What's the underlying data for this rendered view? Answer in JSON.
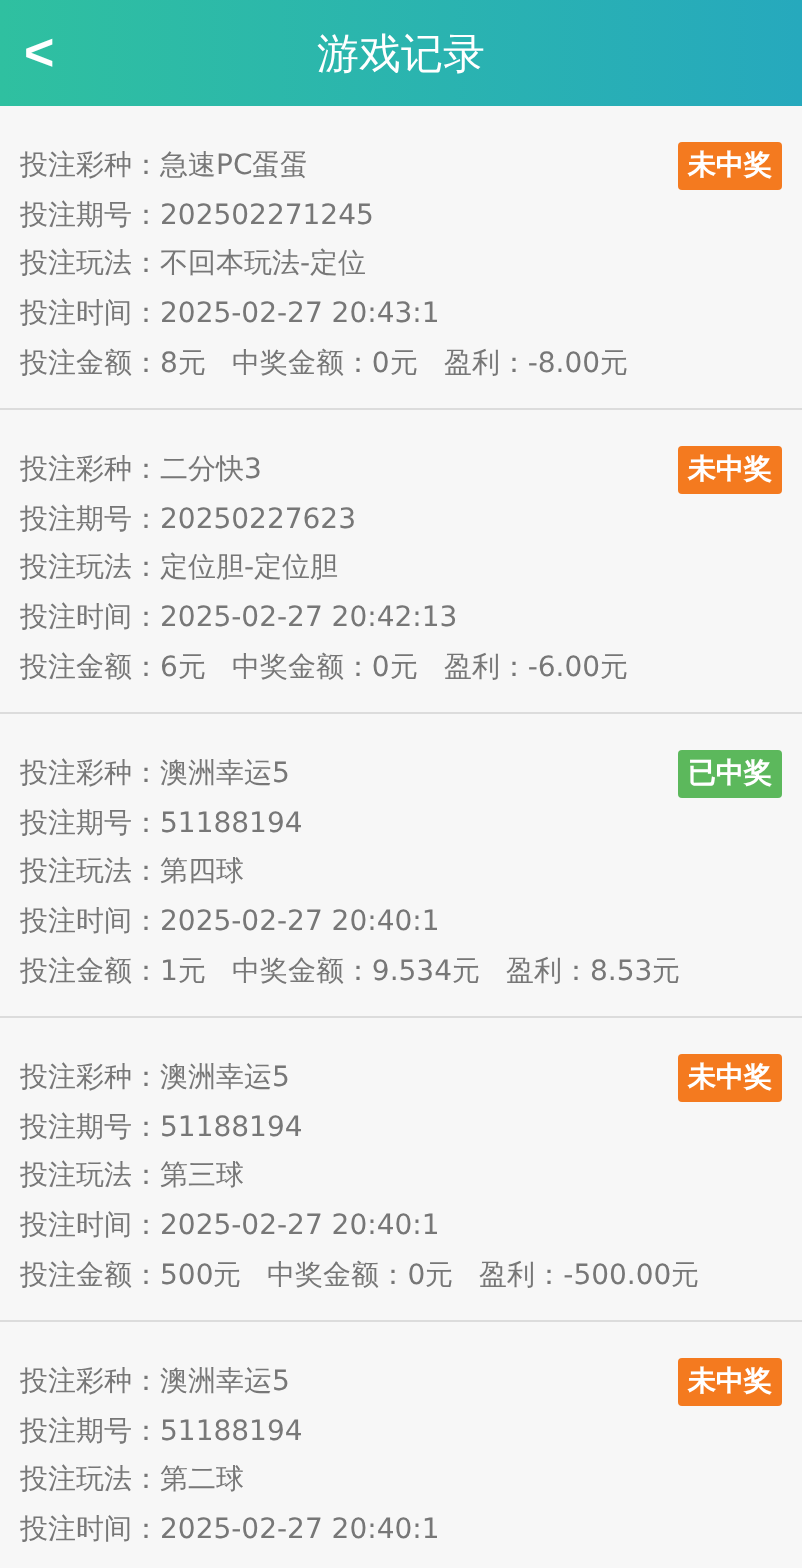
{
  "header": {
    "back": "<",
    "title": "游戏记录"
  },
  "records": [
    {
      "game": "投注彩种：急速PC蛋蛋",
      "status": "未中奖",
      "won": false,
      "issue": "投注期号：202502271245",
      "play": "投注玩法：不回本玩法-定位",
      "time": "投注时间：2025-02-27 20:43:1",
      "amount": "投注金额：8元",
      "prize": "中奖金额：0元",
      "profit": "盈利：-8.00元"
    },
    {
      "game": "投注彩种：二分快3",
      "status": "未中奖",
      "won": false,
      "issue": "投注期号：20250227623",
      "play": "投注玩法：定位胆-定位胆",
      "time": "投注时间：2025-02-27 20:42:13",
      "amount": "投注金额：6元",
      "prize": "中奖金额：0元",
      "profit": "盈利：-6.00元"
    },
    {
      "game": "投注彩种：澳洲幸运5",
      "status": "已中奖",
      "won": true,
      "issue": "投注期号：51188194",
      "play": "投注玩法：第四球",
      "time": "投注时间：2025-02-27 20:40:1",
      "amount": "投注金额：1元",
      "prize": "中奖金额：9.534元",
      "profit": "盈利：8.53元"
    },
    {
      "game": "投注彩种：澳洲幸运5",
      "status": "未中奖",
      "won": false,
      "issue": "投注期号：51188194",
      "play": "投注玩法：第三球",
      "time": "投注时间：2025-02-27 20:40:1",
      "amount": "投注金额：500元",
      "prize": "中奖金额：0元",
      "profit": "盈利：-500.00元"
    },
    {
      "game": "投注彩种：澳洲幸运5",
      "status": "未中奖",
      "won": false,
      "issue": "投注期号：51188194",
      "play": "投注玩法：第二球",
      "time": "投注时间：2025-02-27 20:40:1"
    }
  ]
}
